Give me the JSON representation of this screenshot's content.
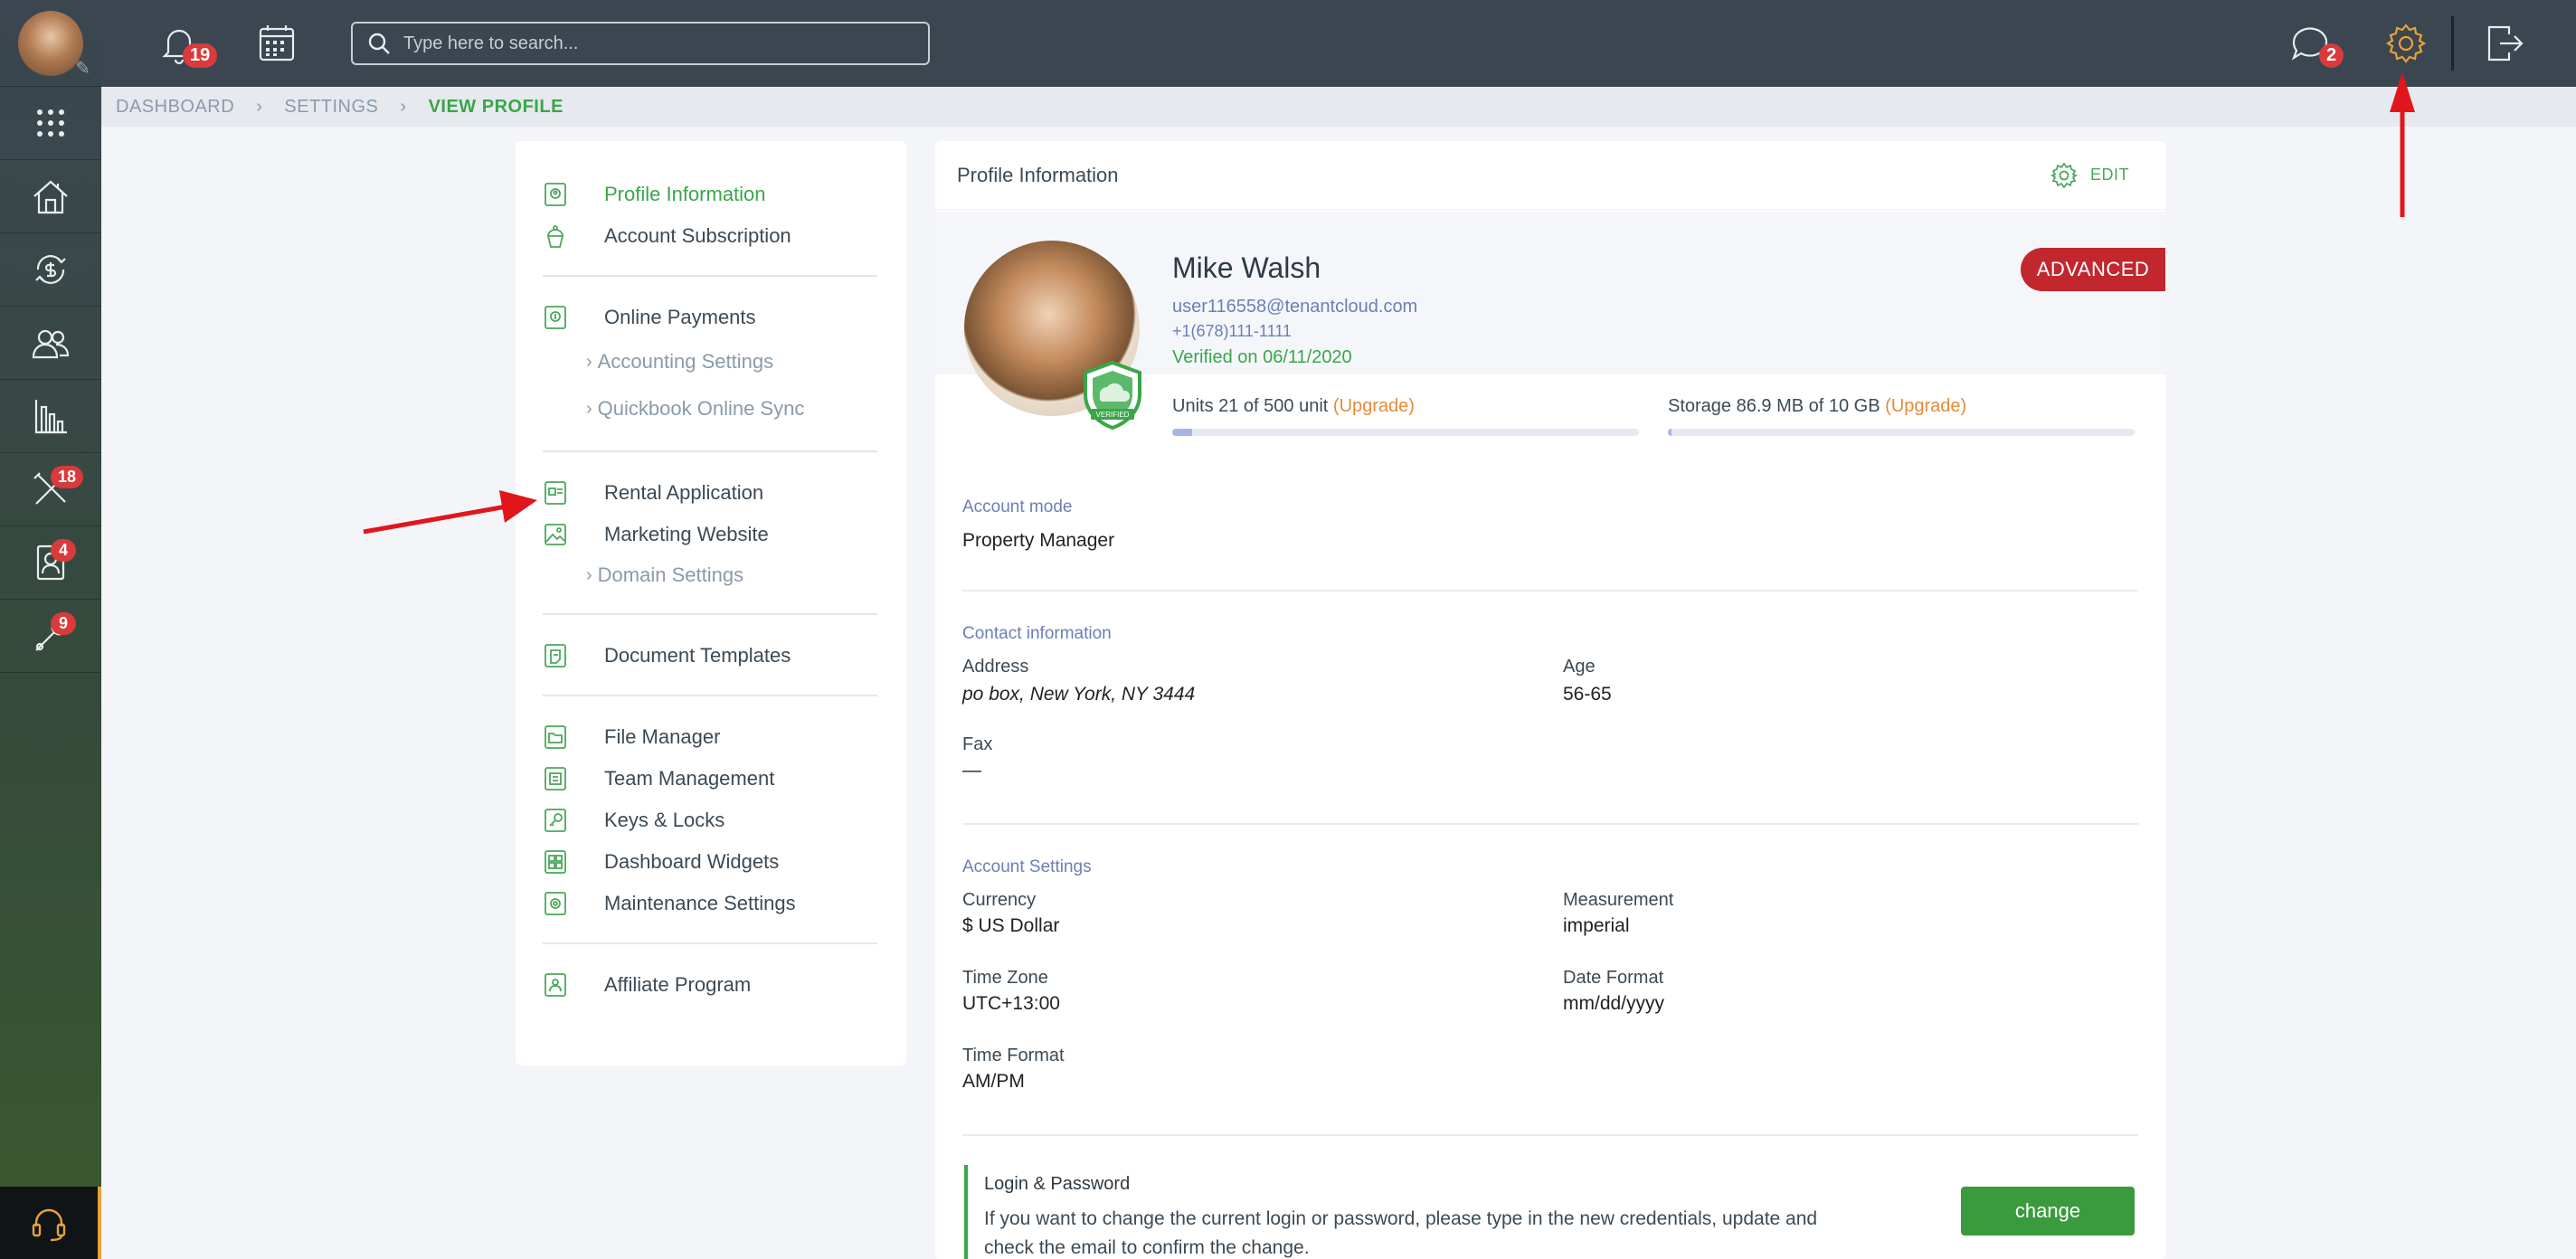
{
  "topbar": {
    "notifications_count": "19",
    "search_placeholder": "Type here to search...",
    "messages_count": "2"
  },
  "sidebar": {
    "items": [
      {
        "icon": "apps-grid-icon"
      },
      {
        "icon": "properties-icon"
      },
      {
        "icon": "payments-icon"
      },
      {
        "icon": "people-icon"
      },
      {
        "icon": "reports-icon"
      },
      {
        "icon": "maintenance-tools-icon",
        "badge": "18"
      },
      {
        "icon": "tenant-contacts-icon",
        "badge": "4"
      },
      {
        "icon": "tools-icon",
        "badge": "9"
      }
    ]
  },
  "breadcrumb": {
    "items": [
      "DASHBOARD",
      "SETTINGS",
      "VIEW PROFILE"
    ]
  },
  "menu": {
    "profile_information": "Profile Information",
    "account_subscription": "Account Subscription",
    "online_payments": "Online Payments",
    "accounting_settings": "Accounting Settings",
    "quickbook_sync": "Quickbook Online Sync",
    "rental_application": "Rental Application",
    "marketing_website": "Marketing Website",
    "domain_settings": "Domain Settings",
    "document_templates": "Document Templates",
    "file_manager": "File Manager",
    "team_management": "Team Management",
    "keys_locks": "Keys & Locks",
    "dashboard_widgets": "Dashboard Widgets",
    "maintenance_settings": "Maintenance Settings",
    "affiliate_program": "Affiliate Program"
  },
  "panel": {
    "title": "Profile Information",
    "edit_label": "EDIT"
  },
  "profile": {
    "name": "Mike Walsh",
    "email": "user116558@tenantcloud.com",
    "phone": "+1(678)111-1111",
    "verified": "Verified on 06/11/2020",
    "plan_badge": "ADVANCED",
    "units_label": "Units 21 of 500 unit",
    "units_upgrade": "(Upgrade)",
    "units_fraction": 0.042,
    "storage_label": "Storage 86.9 MB of 10 GB",
    "storage_upgrade": "(Upgrade)",
    "storage_fraction": 0.0087,
    "shield_text": "VERIFIED"
  },
  "account_mode": {
    "section": "Account mode",
    "value": "Property Manager"
  },
  "contact": {
    "section": "Contact information",
    "address_label": "Address",
    "address_value": "po box, New York, NY 3444",
    "age_label": "Age",
    "age_value": "56-65",
    "fax_label": "Fax",
    "fax_value": "—"
  },
  "account_settings": {
    "section": "Account Settings",
    "currency_label": "Currency",
    "currency_value": "$ US Dollar",
    "measurement_label": "Measurement",
    "measurement_value": "imperial",
    "timezone_label": "Time Zone",
    "timezone_value": "UTC+13:00",
    "dateformat_label": "Date Format",
    "dateformat_value": "mm/dd/yyyy",
    "timeformat_label": "Time Format",
    "timeformat_value": "AM/PM"
  },
  "login": {
    "title": "Login & Password",
    "description": "If you want to change the current login or password, please type in the new credentials, update and check the email to confirm the change.",
    "button": "change"
  },
  "colors": {
    "accent_green": "#3aa648",
    "topbar": "#3b4650",
    "badge_red": "#d93a3a",
    "plan_red": "#c1272d",
    "annotation_red": "#e0161c"
  }
}
